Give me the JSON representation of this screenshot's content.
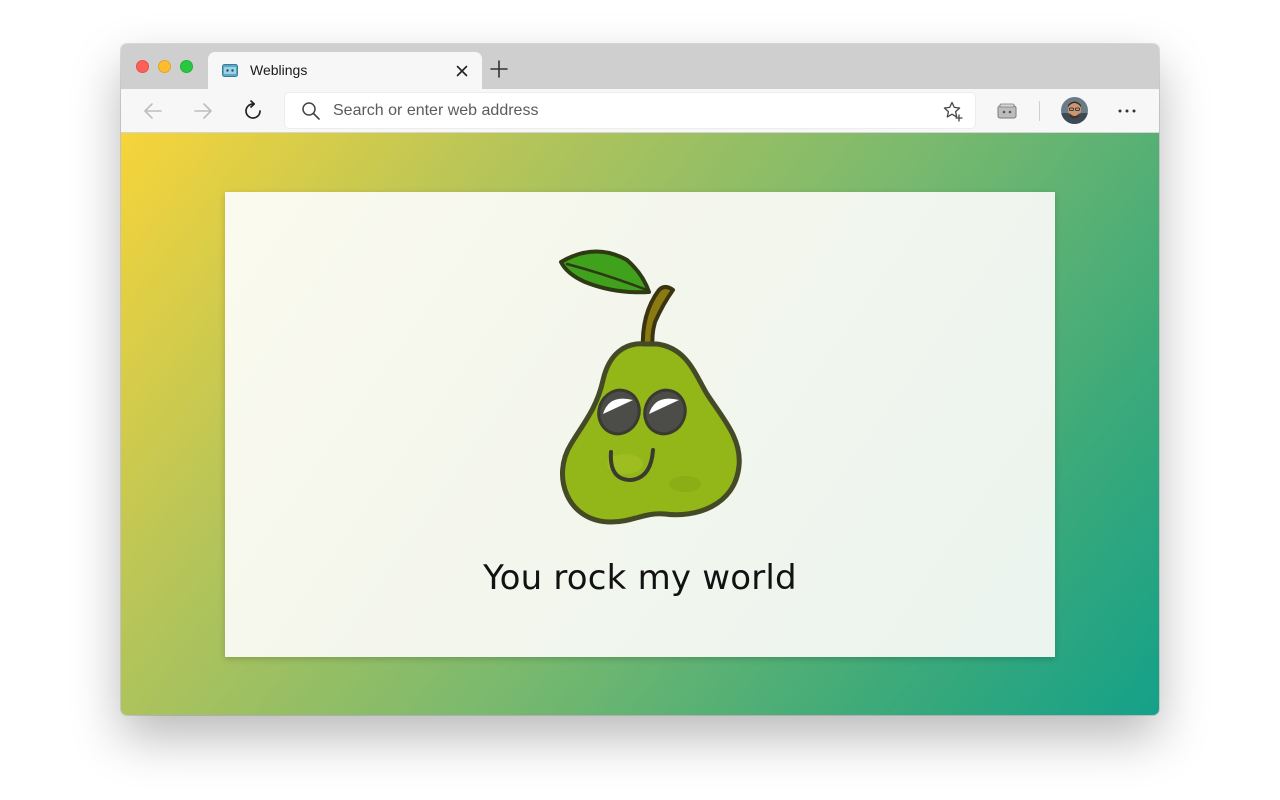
{
  "browser": {
    "tab": {
      "title": "Weblings",
      "favicon": "weblings-favicon-icon"
    },
    "new_tab_icon": "plus-icon",
    "toolbar": {
      "back_icon": "arrow-left-icon",
      "forward_icon": "arrow-right-icon",
      "reload_icon": "reload-icon",
      "address_placeholder": "Search or enter web address",
      "address_value": "",
      "favorite_icon": "star-plus-icon",
      "collections_icon": "collections-icon",
      "profile_icon": "avatar",
      "menu_icon": "more-icon"
    },
    "colors": {
      "tabstrip": "#cfcfcf",
      "toolbar": "#f7f7f7",
      "close": "#fe5f57",
      "minimize": "#febc2e",
      "maximize": "#28c840"
    }
  },
  "page": {
    "message": "You rock my world",
    "illustration": "pear-character",
    "colors": {
      "gradient_start": "#f7d43a",
      "gradient_end": "#14a189",
      "pear_body": "#93b619",
      "pear_leaf": "#3fa11c",
      "pear_stem": "#8a7a10"
    }
  }
}
